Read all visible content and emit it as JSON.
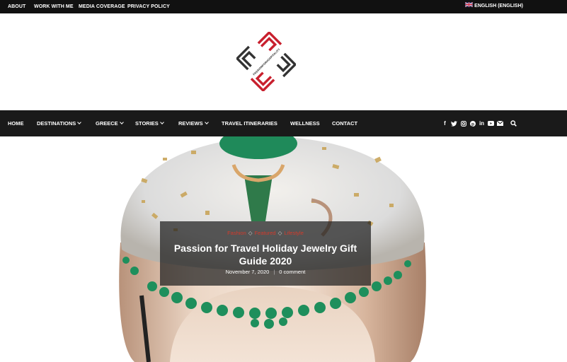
{
  "topbar": {
    "links": [
      "ABOUT",
      "WORK WITH ME",
      "MEDIA COVERAGE",
      "PRIVACY POLICY"
    ],
    "language": "ENGLISH (ENGLISH)"
  },
  "logo": {
    "text": "PASSIONFORHOSPITALITY",
    "colors": {
      "red": "#c8202e",
      "dark": "#333333"
    }
  },
  "nav": {
    "items": [
      {
        "label": "HOME"
      },
      {
        "label": "DESTINATIONS"
      },
      {
        "label": "GREECE"
      },
      {
        "label": "STORIES"
      },
      {
        "label": "REVIEWS"
      },
      {
        "label": "TRAVEL ITINERARIES"
      },
      {
        "label": "WELLNESS"
      },
      {
        "label": "CONTACT"
      }
    ],
    "social_icons": [
      "facebook-icon",
      "twitter-icon",
      "instagram-icon",
      "pinterest-icon",
      "linkedin-icon",
      "youtube-icon",
      "email-icon",
      "search-icon"
    ]
  },
  "hero": {
    "categories": [
      "Fashion",
      "Featured",
      "Lifestyle"
    ],
    "title": "Passion for Travel Holiday Jewelry Gift Guide 2020",
    "date": "November 7, 2020",
    "comments": "0 comment"
  },
  "colors": {
    "accent": "#d33a2c",
    "nav_bg": "#1a1a1a",
    "topbar_bg": "#111111"
  }
}
